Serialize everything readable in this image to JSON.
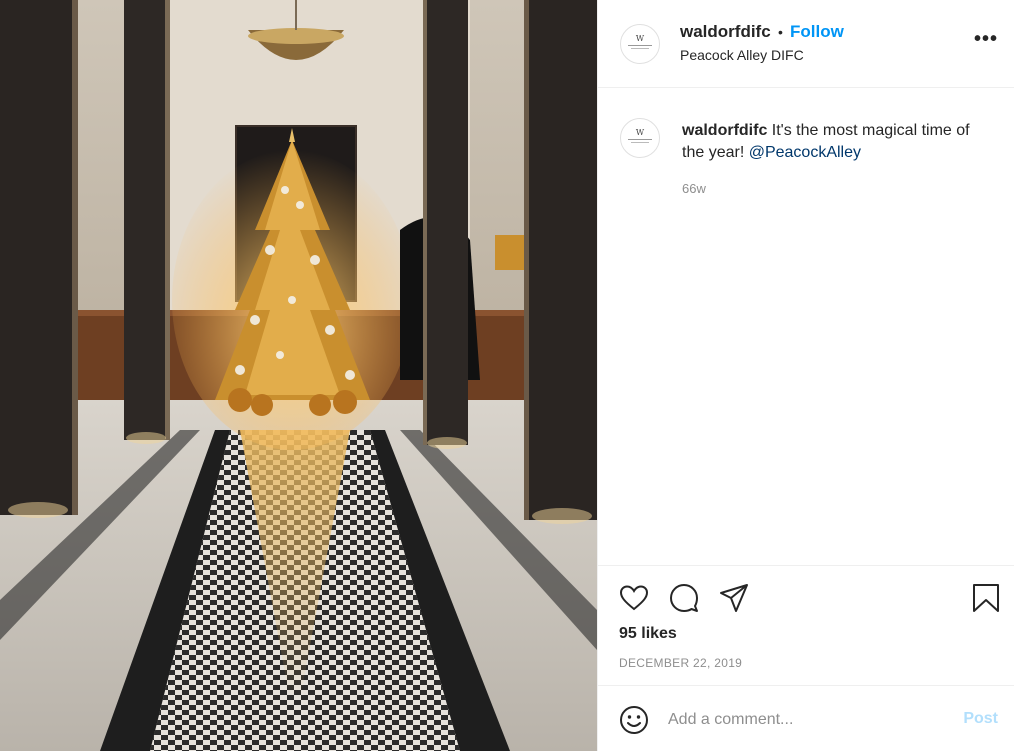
{
  "post": {
    "image_alt": "Christmas tree in a marble hotel lobby",
    "header": {
      "username": "waldorfdifc",
      "separator": "•",
      "follow_label": "Follow",
      "location": "Peacock Alley DIFC",
      "more_label": "•••"
    },
    "caption": {
      "username": "waldorfdifc",
      "text": " It's the most magical time of the year! ",
      "mention": "@PeacockAlley",
      "age": "66w"
    },
    "actions": {
      "like_icon": "heart-icon",
      "comment_icon": "comment-icon",
      "share_icon": "paper-plane-icon",
      "save_icon": "bookmark-icon"
    },
    "likes": "95 likes",
    "date": "DECEMBER 22, 2019",
    "comment": {
      "placeholder": "Add a comment...",
      "post_label": "Post",
      "emoji_icon": "smiley-icon"
    }
  },
  "colors": {
    "follow": "#0095f6",
    "mention": "#00376b",
    "muted": "#8e8e8e",
    "post_disabled": "#b2dffc"
  }
}
